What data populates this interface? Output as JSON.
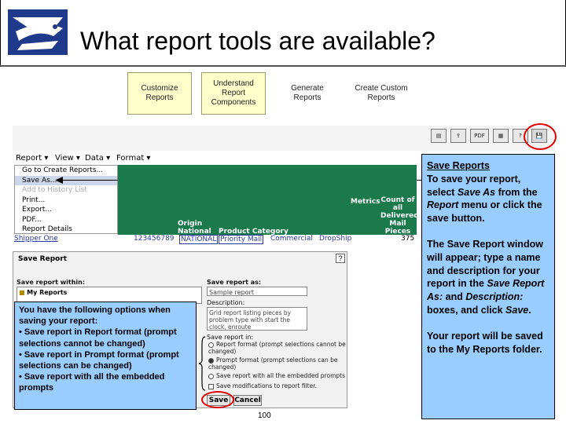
{
  "slide": {
    "title": "What report tools are available?",
    "page_number": "100"
  },
  "tools": [
    {
      "label": "Customize Reports"
    },
    {
      "label": "Understand Report Components"
    },
    {
      "label": "Generate Reports"
    },
    {
      "label": "Create Custom Reports"
    }
  ],
  "report_screen": {
    "toolbar_icons": [
      "printer-icon",
      "export-icon",
      "pdf-icon",
      "excel-icon",
      "help-icon",
      "save-icon"
    ],
    "pdf_label": "PDF",
    "help_label": "?",
    "menu": {
      "report": "Report",
      "view": "View",
      "data": "Data",
      "format": "Format"
    },
    "report_menu_items": [
      {
        "label": "Go to Create Reports..."
      },
      {
        "label": "Save As..."
      },
      {
        "label": "Add to History List"
      },
      {
        "label": "Print..."
      },
      {
        "label": "Export..."
      },
      {
        "label": "PDF..."
      },
      {
        "label": "Report Details"
      }
    ],
    "columns": {
      "metrics": "Metrics",
      "count": "Count of all Delivered Mail Pieces",
      "origin": "Origin National",
      "product_category": "Product Category",
      "shipper": "Shipper One"
    },
    "row": {
      "id": "123456789",
      "origin": "NATIONAL",
      "priority": "Priority Mail",
      "commercial": "Commercial",
      "dropship": "DropShip",
      "count": "375"
    }
  },
  "dialog": {
    "title": "Save Report",
    "help": "?",
    "save_within_label": "Save report within:",
    "folder": "My Reports",
    "save_as_label": "Save report as:",
    "save_as_value": "Sample report",
    "description_label": "Description:",
    "description_value": "Grid report listing pieces by problem type with start the clock, enroute",
    "save_in_label": "Save report in:",
    "options": [
      {
        "label": "Report format (prompt selections cannot be changed)",
        "selected": false
      },
      {
        "label": "Prompt format (prompt selections can be changed)",
        "selected": true
      },
      {
        "label": "Save report with all the embedded prompts",
        "selected": false
      }
    ],
    "save_modifications": "Save modifications to report filter.",
    "save_button": "Save",
    "cancel_button": "Cancel"
  },
  "options_callout": {
    "text": "You have the following options when saving your report:\n• Save report in Report format (prompt selections cannot be changed)\n• Save report in Prompt format (prompt selections can be changed)\n• Save report with all the embedded prompts"
  },
  "right_callout": {
    "heading": "Save Reports",
    "p1_a": "To save your report, select ",
    "p1_em1": "Save As",
    "p1_b": " from the ",
    "p1_em2": "Report",
    "p1_c": " menu or click the save button.",
    "p2_a": "The Save Report window will appear; type a name and description for your report in the ",
    "p2_em1": "Save Report As:",
    "p2_b": " and ",
    "p2_em2": "Description:",
    "p2_c": " boxes, and click ",
    "p2_em3": "Save",
    "p2_d": ".",
    "p3": "Your report will be saved to the My Reports folder."
  },
  "colors": {
    "callout_blue": "#99ccff",
    "report_green": "#1a7a4c",
    "highlight_red": "#e00000",
    "tool_yellow": "#ffffcc"
  }
}
